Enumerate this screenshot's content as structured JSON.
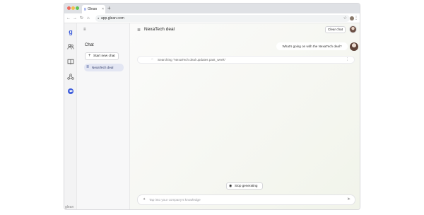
{
  "browser": {
    "tab_title": "Glean",
    "tab_favicon": "g",
    "tab_close": "×",
    "new_tab_label": "+",
    "url": "app.glean.com",
    "back": "←",
    "forward": "→",
    "reload": "↻",
    "home": "⌂",
    "star": "☆",
    "more": "⋮"
  },
  "rail": {
    "logo": "g",
    "footer_brand": "glean"
  },
  "sidebar": {
    "menu_icon": "≡",
    "title": "Chat",
    "new_chat_label": "Start new chat",
    "new_chat_icon": "+",
    "conversations": [
      {
        "label": "NexaTech deal",
        "icon": "≣"
      }
    ]
  },
  "main": {
    "header_icon": "≣",
    "title": "NexaTech deal",
    "clear_label": "Clear chat",
    "user_message": "What's going on with the NexaTech deal?",
    "status_icon": "◌",
    "status_text": "Searching \"NexaTech deal updates past_week\"",
    "status_menu": "⋮",
    "stop_label": "Stop generating",
    "stop_icon": "◉",
    "composer_icon": "✦",
    "composer_placeholder": "Tap into your company's knowledge",
    "send_icon": "➤"
  },
  "colors": {
    "accent": "#3b5bdb",
    "active_conversation_bg": "#e3e6f3"
  }
}
